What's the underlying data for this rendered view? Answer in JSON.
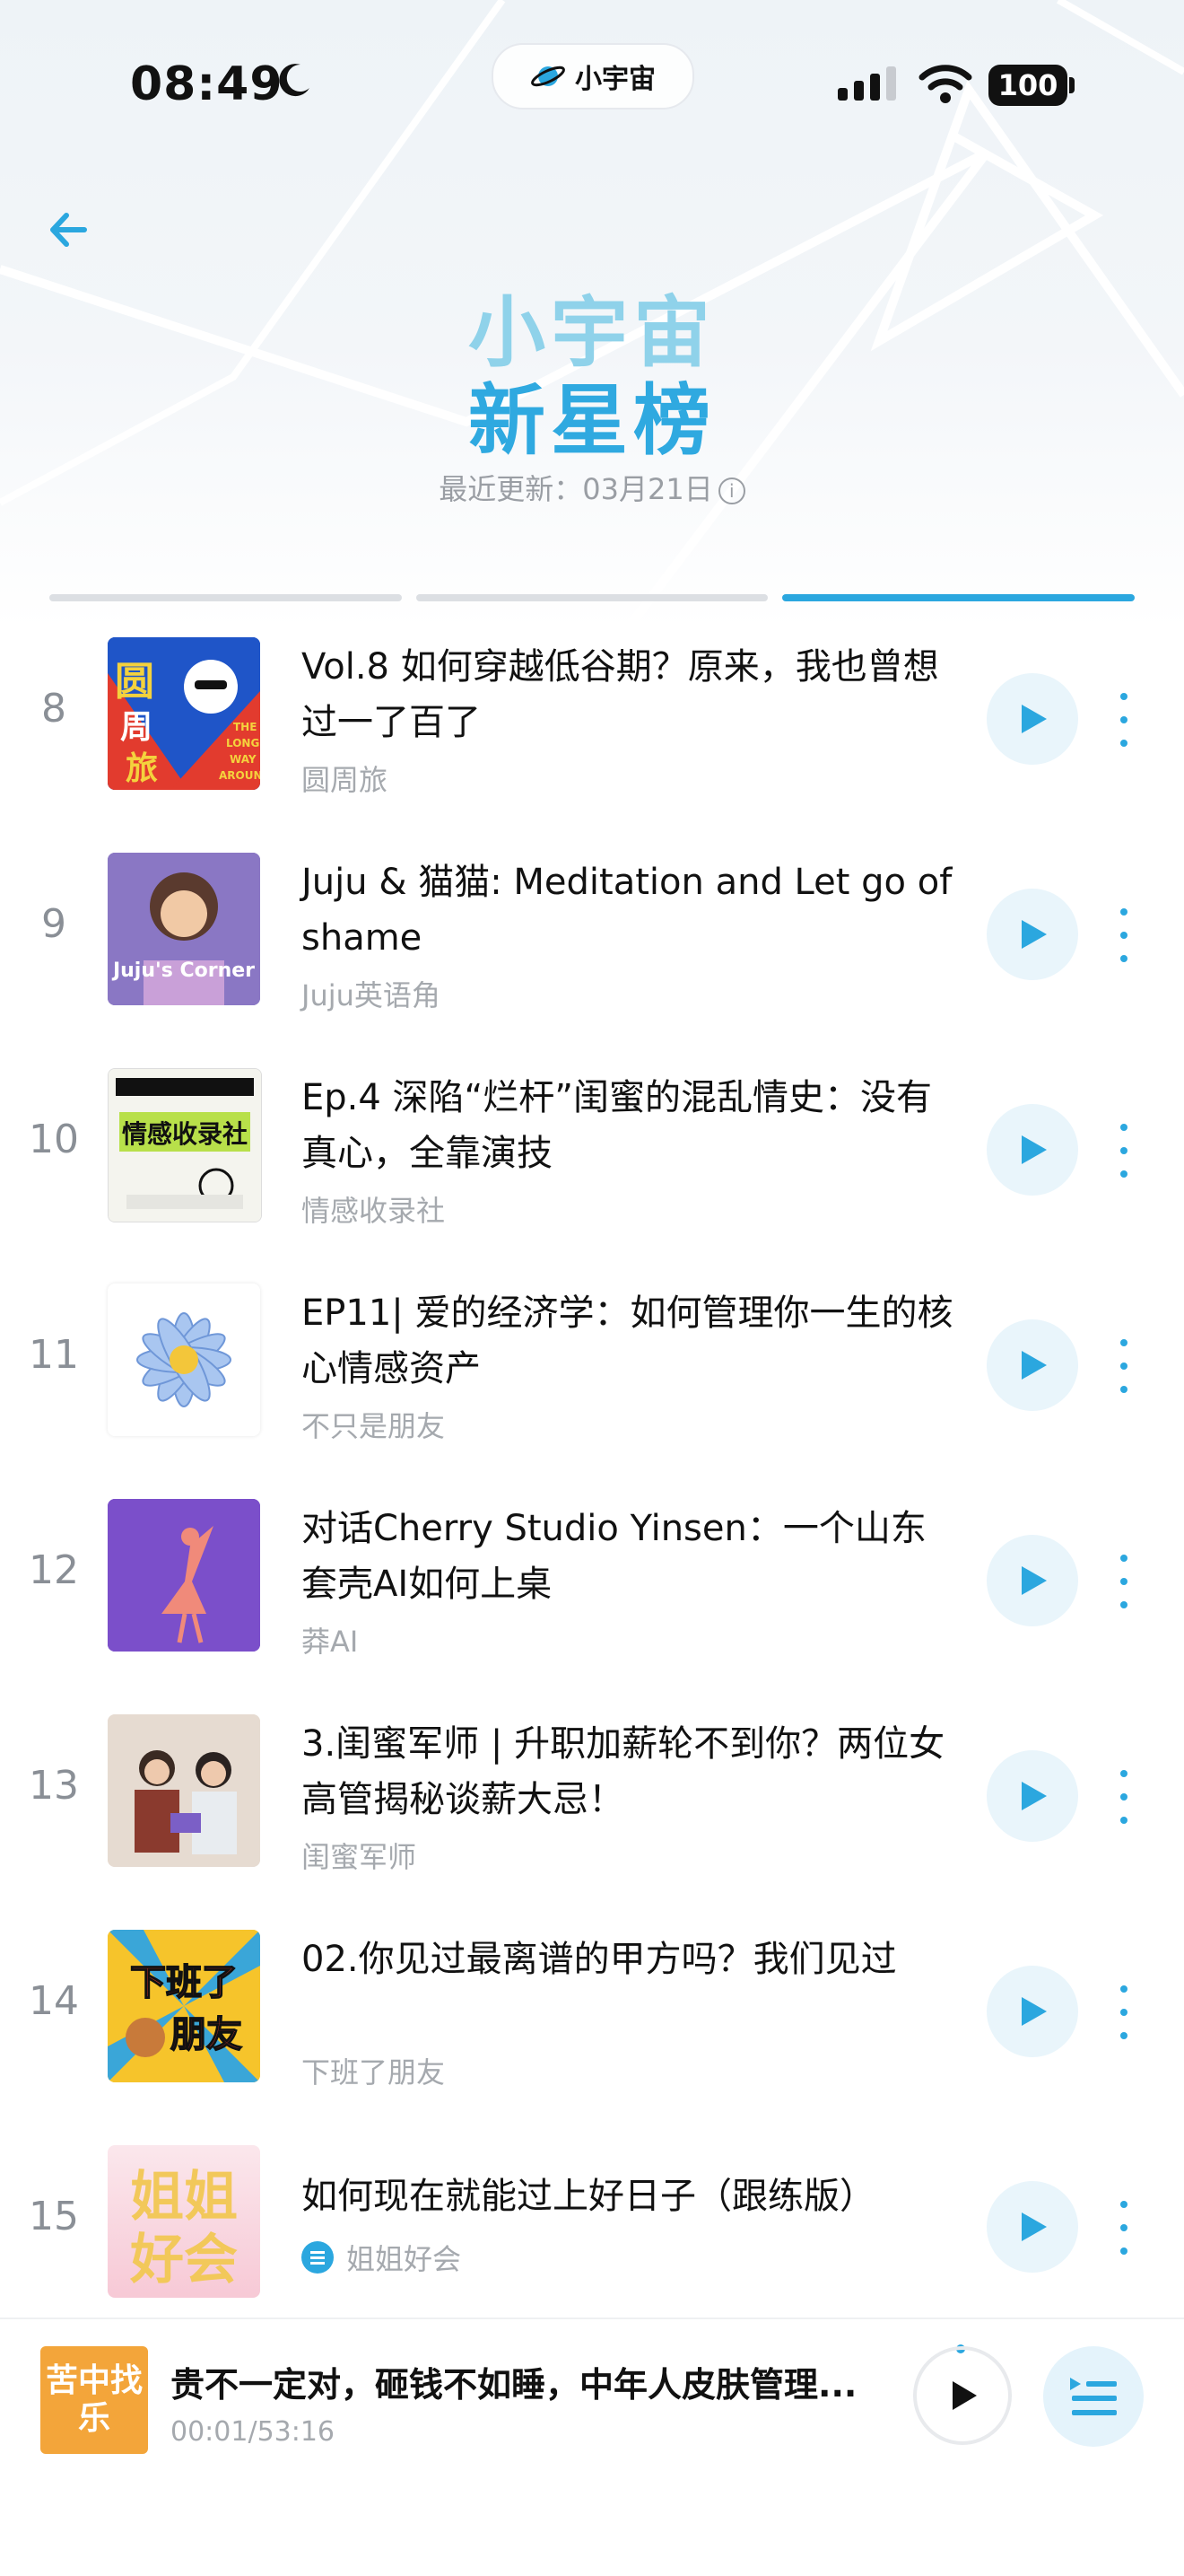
{
  "status_bar": {
    "time": "08:49",
    "island_label": "小宇宙",
    "battery": "100"
  },
  "header": {
    "title_line1": "小宇宙",
    "title_line2": "新星榜",
    "updated_label": "最近更新：",
    "updated_date": "03月21日",
    "info_icon": "i"
  },
  "colors": {
    "accent": "#2ba7df",
    "title_light": "#8fd2ea",
    "muted": "#a5a9ae"
  },
  "tabs": {
    "count": 3,
    "active_index": 2
  },
  "episodes": [
    {
      "rank": "8",
      "title": "Vol.8 如何穿越低谷期？原来，我也曾想过一了百了",
      "show": "圆周旅",
      "cover_text": "圆周旅 THE LONG WAY AROUND"
    },
    {
      "rank": "9",
      "title": "Juju & 猫猫: Meditation and Let go of shame",
      "show": "Juju英语角",
      "cover_text": "Juju's Corner"
    },
    {
      "rank": "10",
      "title": "Ep.4 深陷“烂杆”闺蜜的混乱情史：没有真心，全靠演技",
      "show": "情感收录社",
      "cover_text": "情感收录社"
    },
    {
      "rank": "11",
      "title": "EP11| 爱的经济学：如何管理你一生的核心情感资产",
      "show": "不只是朋友",
      "cover_text": ""
    },
    {
      "rank": "12",
      "title": "对话Cherry Studio Yinsen：一个山东套壳AI如何上桌",
      "show": "莽AI",
      "cover_text": ""
    },
    {
      "rank": "13",
      "title": "3.闺蜜军师 | 升职加薪轮不到你？两位女高管揭秘谈薪大忌！",
      "show": "闺蜜军师",
      "cover_text": ""
    },
    {
      "rank": "14",
      "title": "02.你见过最离谱的甲方吗？我们见过",
      "show": "下班了朋友",
      "cover_text": "下班了朋友"
    },
    {
      "rank": "15",
      "title": "如何现在就能过上好日子（跟练版）",
      "show": "姐姐好会",
      "cover_text": "姐姐好会"
    }
  ],
  "player": {
    "cover_text": "苦中找乐",
    "title": "贵不一定对，砸钱不如睡，中年人皮肤管理...",
    "time": "00:01/53:16"
  }
}
